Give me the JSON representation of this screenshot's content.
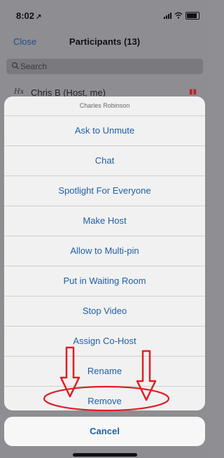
{
  "status_bar": {
    "time": "8:02",
    "location_arrow": "↗"
  },
  "nav": {
    "close_label": "Close",
    "title": "Participants (13)"
  },
  "search": {
    "placeholder": "Search"
  },
  "participant": {
    "name": "Chris B (Host, me)"
  },
  "sheet": {
    "title": "Charles Robinson",
    "options": [
      "Ask to Unmute",
      "Chat",
      "Spotlight For Everyone",
      "Make Host",
      "Allow to Multi-pin",
      "Put in Waiting Room",
      "Stop Video",
      "Assign Co-Host",
      "Rename",
      "Remove"
    ],
    "cancel_label": "Cancel"
  },
  "colors": {
    "accent": "#1f5fa8",
    "annotation": "#e01d25",
    "dim_background": "#8e8e92"
  },
  "icons": [
    "location-arrow-icon",
    "signal-icon",
    "wifi-icon",
    "battery-icon",
    "search-icon",
    "signature-icon",
    "mic-muted-icon"
  ]
}
